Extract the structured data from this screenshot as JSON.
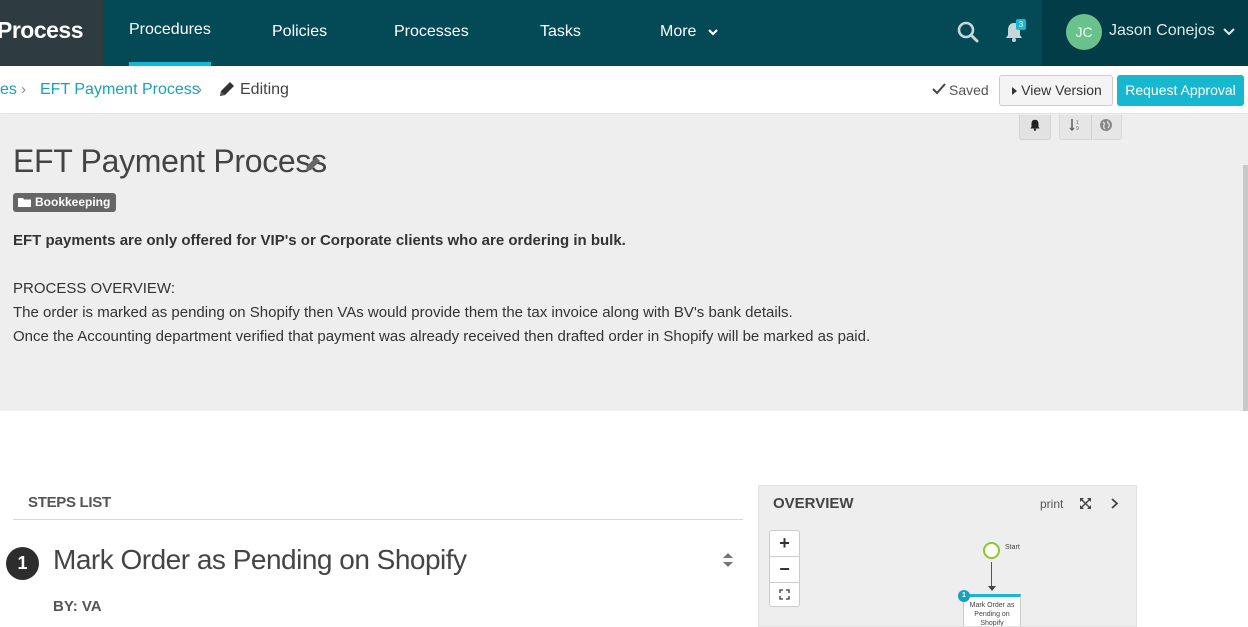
{
  "app": {
    "logo_text": "tProcess"
  },
  "nav": {
    "items": [
      {
        "label": "Procedures"
      },
      {
        "label": "Policies"
      },
      {
        "label": "Processes"
      },
      {
        "label": "Tasks"
      },
      {
        "label": "More"
      }
    ],
    "active": "Procedures",
    "notification_count": "3",
    "user": {
      "initials": "JC",
      "name": "Jason Conejos",
      "avatar_color": "#69c28b"
    },
    "icons": [
      "search-icon",
      "bell-icon",
      "chevron-down-icon"
    ]
  },
  "breadcrumb": {
    "items": [
      {
        "label": "es"
      },
      {
        "label": "EFT Payment Process"
      }
    ],
    "separator": "›",
    "current": "Editing",
    "status": "Saved",
    "view_version_label": "View Version",
    "request_approval_label": "Request Approval"
  },
  "procedure": {
    "title": "EFT Payment Process",
    "tag": "Bookkeeping",
    "description_lines": [
      {
        "text": "EFT payments are only offered for VIP's or Corporate clients who are ordering in bulk.",
        "bold": true
      },
      {
        "text": "PROCESS OVERVIEW:",
        "bold": false
      },
      {
        "text": "The order is marked as pending on Shopify then VAs would provide them the tax invoice along with BV's bank details.",
        "bold": false
      },
      {
        "text": "Once the Accounting department verified that payment was already received then drafted order in Shopify will be marked as paid.",
        "bold": false
      }
    ]
  },
  "steps": {
    "heading": "STEPS LIST",
    "items": [
      {
        "number": "1",
        "title": "Mark Order as Pending on Shopify",
        "by": "BY: VA"
      }
    ]
  },
  "overview": {
    "title": "OVERVIEW",
    "print_label": "print",
    "zoom_in": "+",
    "zoom_out": "−",
    "flow": {
      "start_label": "Start",
      "nodes": [
        {
          "number": "1",
          "label": "Mark Order as Pending on Shopify"
        }
      ]
    }
  },
  "colors": {
    "nav_bg": "#034a56",
    "accent": "#17b8cf",
    "link": "#17a2b8",
    "hero_bg": "#eeeeee"
  }
}
